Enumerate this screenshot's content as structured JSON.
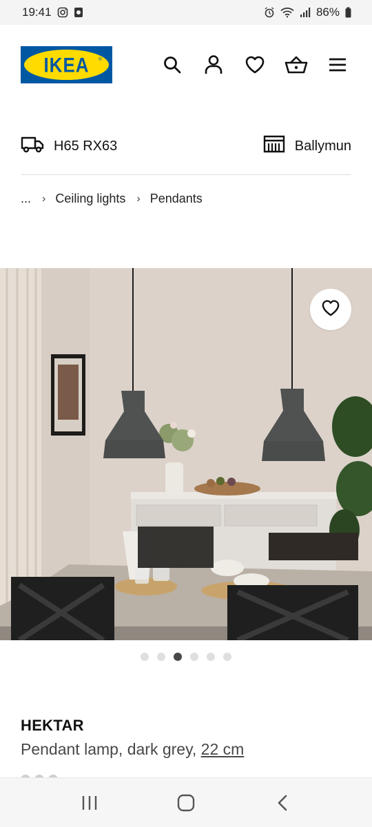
{
  "status_bar": {
    "time": "19:41",
    "battery": "86%",
    "icons": [
      "instagram-icon",
      "app-icon",
      "alarm-icon",
      "wifi-icon",
      "signal-icon",
      "battery-icon"
    ]
  },
  "header": {
    "logo_text": "IKEA",
    "logo_registered": "®",
    "icons": [
      "search-icon",
      "account-icon",
      "wishlist-heart-icon",
      "basket-icon",
      "menu-icon"
    ],
    "brand_colors": {
      "blue": "#0058a3",
      "yellow": "#ffdb00"
    }
  },
  "location": {
    "delivery_postcode": "H65 RX63",
    "store": "Ballymun"
  },
  "breadcrumb": {
    "ellipsis": "...",
    "items": [
      "Ceiling lights",
      "Pendants"
    ]
  },
  "carousel": {
    "total": 6,
    "active_index": 2
  },
  "product": {
    "name": "HEKTAR",
    "description": "Pendant lamp, dark grey, ",
    "size": "22 cm"
  },
  "nav_bar": {
    "icons": [
      "recent-apps-icon",
      "home-icon",
      "back-icon"
    ]
  }
}
